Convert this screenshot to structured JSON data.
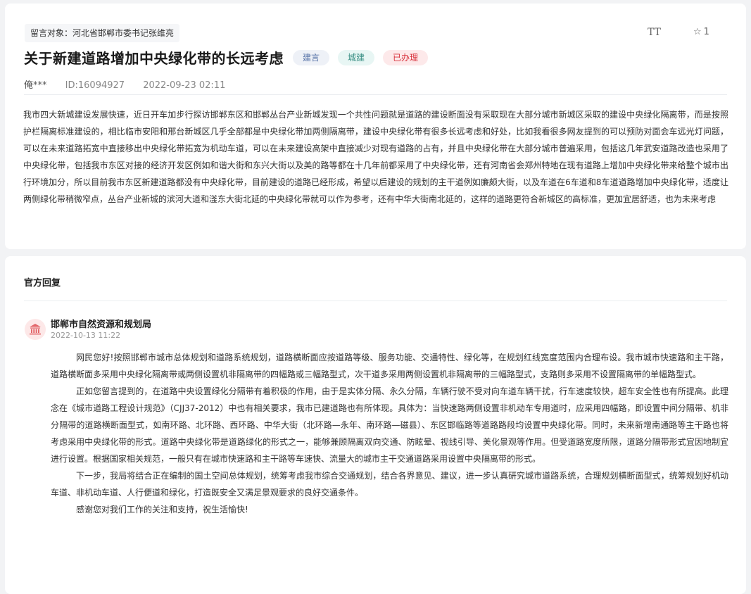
{
  "message": {
    "target": "留言对象：河北省邯郸市委书记张维亮",
    "font_tool_label": "TT",
    "favorite_count": "1",
    "title": "关于新建道路增加中央绿化带的长远考虑",
    "tags": [
      "建言",
      "城建",
      "已办理"
    ],
    "user": "俺***",
    "id": "ID:16094927",
    "time": "2022-09-23 02:11",
    "content": "我市四大新城建设发展快速，近日开车加步行探访邯郸东区和邯郸丛台产业新城发现一个共性问题就是道路的建设断面没有采取现在大部分城市新城区采取的建设中央绿化隔离带，而是按照护栏隔离标准建设的，相比临市安阳和邢台新城区几乎全部都是中央绿化带加两侧隔离带，建设中央绿化带有很多长远考虑和好处，比如我看很多网友提到的可以预防对面会车远光灯问题，可以在未来道路拓宽中直接移出中央绿化带拓宽为机动车道，可以在未来建设高架中直接减少对现有道路的占有，并且中央绿化带在大部分城市普遍采用，包括这几年武安道路改造也采用了中央绿化带，包括我市东区对接的经济开发区例如和谐大街和东兴大街以及美的路等都在十几年前都采用了中央绿化带，还有河南省会郑州特地在现有道路上增加中央绿化带来给整个城市出行环境加分，所以目前我市东区新建道路都没有中央绿化带，目前建设的道路已经形成，希望以后建设的规划的主干道例如廉颇大街，以及车道在6车道和8车道道路增加中央绿化带，适度让两侧绿化带稍微窄点，丛台产业新城的滨河大道和滏东大街北延的中央绿化带就可以作为参考，还有中华大街南北延的，这样的道路更符合新城区的高标准，更加宜居舒适，也为未来考虑"
  },
  "reply": {
    "section_title": "官方回复",
    "avatar_icon": "government-building-icon",
    "org": "邯郸市自然资源和规划局",
    "time": "2022-10-13 11:22",
    "paragraphs": [
      "网民您好!按照邯郸市城市总体规划和道路系统规划，道路横断面应按道路等级、服务功能、交通特性、绿化等，在规划红线宽度范围内合理布设。我市城市快速路和主干路，道路横断面多采用中央绿化隔离带或两侧设置机非隔离带的四幅路或三幅路型式，次干道多采用两侧设置机非隔离带的三幅路型式，支路则多采用不设置隔离带的单幅路型式。",
      "正如您留言提到的，在道路中央设置绿化分隔带有着积极的作用，由于是实体分隔、永久分隔，车辆行驶不受对向车道车辆干扰，行车速度较快，超车安全性也有所提高。此理念在《城市道路工程设计规范》（CJJ37-2012）中也有相关要求，我市已建道路也有所体现。具体为：当快速路两侧设置非机动车专用道时，应采用四幅路，即设置中间分隔带、机非分隔带的道路横断面型式，如南环路、北环路、西环路、中华大街（北环路—永年、南环路—磁县）、东区邯临路等道路路段均设置中央绿化带。同时，未来新增南通路等主干路也将考虑采用中央绿化带的形式。道路中央绿化带是道路绿化的形式之一，能够兼顾隔离双向交通、防眩晕、视线引导、美化景观等作用。但受道路宽度所限，道路分隔带形式宜因地制宜进行设置。根据国家相关规范，一般只有在城市快速路和主干路等车速快、流量大的城市主干交通道路采用设置中央隔离带的形式。",
      "下一步，我局将结合正在编制的国土空间总体规划，统筹考虑我市综合交通规划，结合各界意见、建议，进一步认真研究城市道路系统，合理规划横断面型式，统筹规划好机动车道、非机动车道、人行便道和绿化，打造既安全又满足景观要求的良好交通条件。",
      "感谢您对我们工作的关注和支持，祝生活愉快!"
    ]
  }
}
